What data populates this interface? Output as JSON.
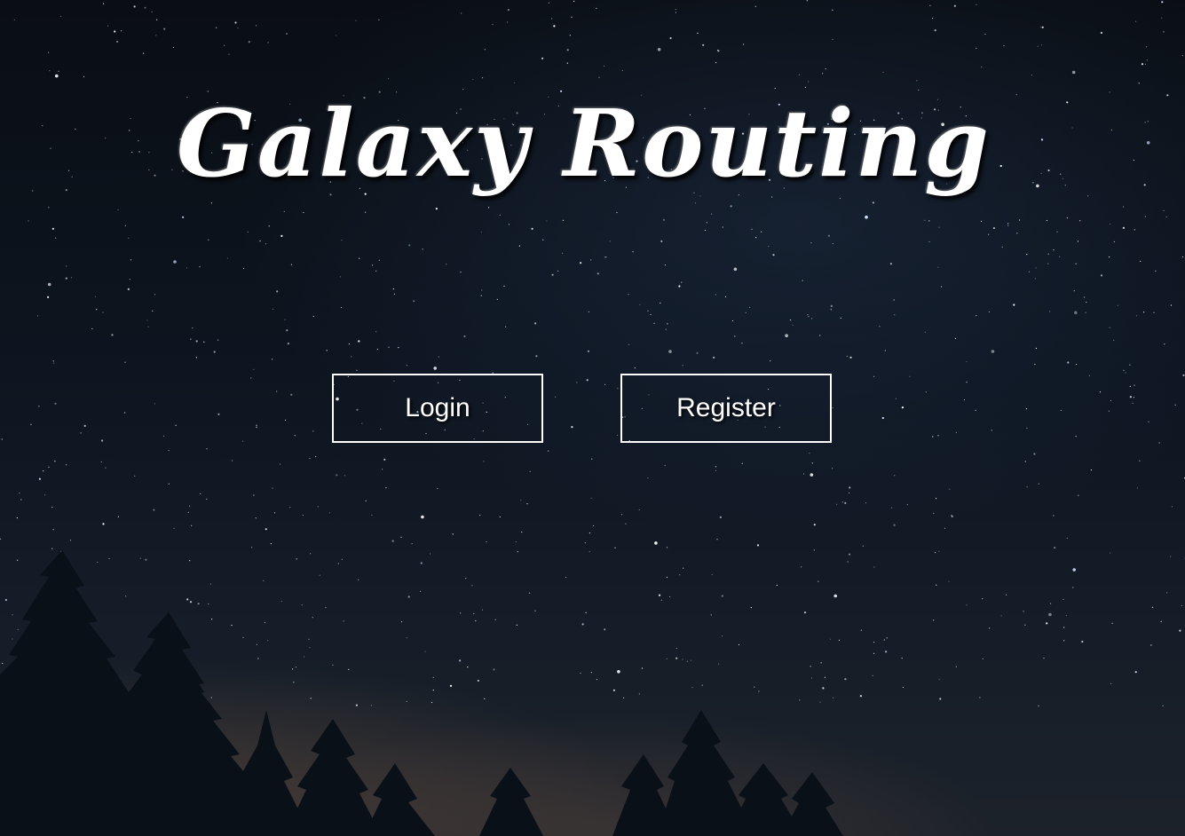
{
  "page": {
    "title": "Galaxy Routing"
  },
  "actions": {
    "login_label": "Login",
    "register_label": "Register"
  },
  "colors": {
    "text": "#ffffff",
    "button_border": "#ffffff",
    "sky_top": "#0a0e14",
    "sky_bottom": "#1d222a",
    "tree_silhouette": "#0a1018"
  },
  "background": {
    "subject": "starry-night-sky-with-pine-trees"
  }
}
